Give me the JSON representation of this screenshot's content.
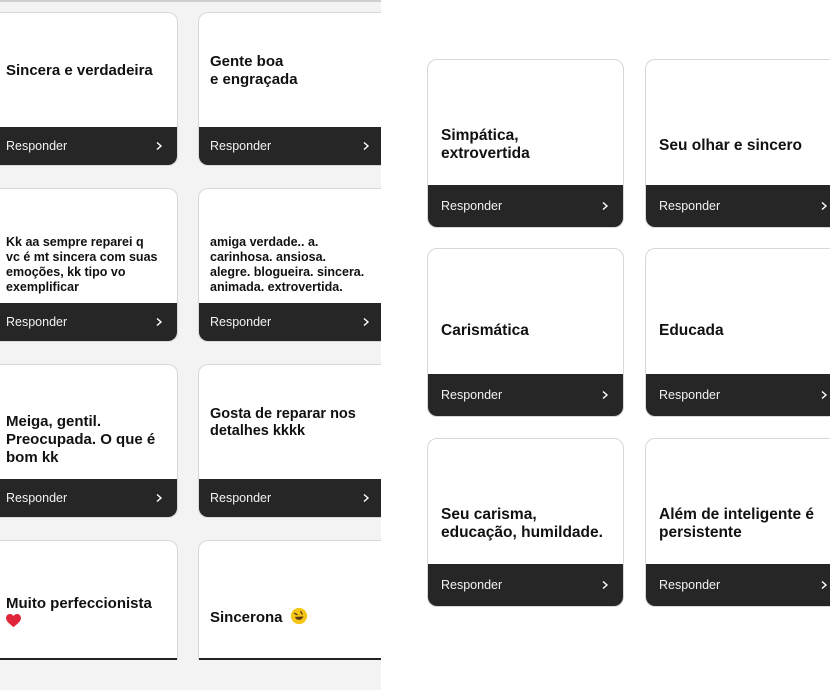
{
  "left_column": {
    "cards": [
      {
        "question": "Sincera e verdadeira",
        "reply_label": "Responder"
      },
      {
        "question": "Gente boa\ne engraçada",
        "reply_label": "Responder"
      },
      {
        "question": "Kk aa sempre reparei q\nvc é mt sincera com suas\nemoções, kk tipo vo\nexemplificar",
        "reply_label": "Responder"
      },
      {
        "question": "amiga verdade.. a.\ncarinhosa.  ansiosa.\nalegre. blogueira. sincera.\nanimada. extrovertida.",
        "reply_label": "Responder"
      },
      {
        "question": "Meiga, gentil.\nPreocupada. O que é\nbom kk",
        "reply_label": "Responder"
      },
      {
        "question": "Gosta de reparar nos\ndetalhes kkkk",
        "reply_label": "Responder"
      },
      {
        "question": "Muito perfeccionista",
        "icon": "red-heart-icon"
      },
      {
        "question": "Sincerona",
        "icon": "rolling-laughing-emoji-icon"
      }
    ]
  },
  "right_column": {
    "cards": [
      {
        "question": "Simpática,\nextrovertida",
        "reply_label": "Responder"
      },
      {
        "question": "Seu olhar e sincero",
        "reply_label": "Responder"
      },
      {
        "question": "Carismática",
        "reply_label": "Responder"
      },
      {
        "question": "Educada",
        "reply_label": "Responder"
      },
      {
        "question": "Seu carisma,\neducação, humildade.",
        "reply_label": "Responder"
      },
      {
        "question": "Além de inteligente é\npersistente",
        "reply_label": "Responder"
      }
    ]
  },
  "icons": {
    "reply_chevron": "chevron-right-icon",
    "heart": "red-heart-icon",
    "emoji": "rolling-laughing-emoji-icon"
  },
  "colors": {
    "reply_bar": "#262626",
    "card_border": "#d7d7d7",
    "left_background": "#f3f3f3",
    "heart": "#e0243a",
    "emoji": "#f5c518"
  }
}
